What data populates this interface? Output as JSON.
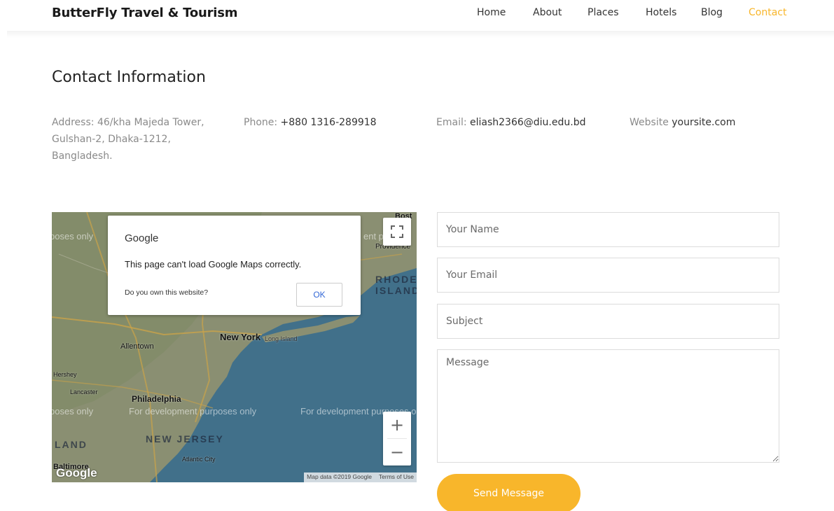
{
  "header": {
    "brand": "ButterFly Travel & Tourism",
    "nav": [
      {
        "label": "Home",
        "active": false
      },
      {
        "label": "About",
        "active": false
      },
      {
        "label": "Places",
        "active": false
      },
      {
        "label": "Hotels",
        "active": false
      },
      {
        "label": "Blog",
        "active": false
      },
      {
        "label": "Contact",
        "active": true
      }
    ]
  },
  "contact": {
    "title": "Contact Information",
    "address_label": "Address:",
    "address_lines": [
      "46/kha Majeda Tower,",
      "Gulshan-2, Dhaka-1212,",
      "Bangladesh."
    ],
    "phone_label": "Phone:",
    "phone": "+880 1316-289918",
    "email_label": "Email:",
    "email": "eliash2366@diu.edu.bd",
    "website_label": "Website",
    "website": "yoursite.com"
  },
  "map": {
    "dialog_brand": "Google",
    "dialog_message": "This page can't load Google Maps correctly.",
    "dialog_question": "Do you own this website?",
    "dialog_ok": "OK",
    "watermark": "For development purposes only",
    "watermark_left": "poses only",
    "watermark_right": "ent p",
    "places": {
      "new_york": "New York",
      "long_island": "Long Island",
      "allentown": "Allentown",
      "philadelphia": "Philadelphia",
      "lancaster": "Lancaster",
      "hershey": "Hershey",
      "atlantic_city": "Atlantic City",
      "baltimore": "Baltimore",
      "providence": "Providence",
      "rhode": "RHODE",
      "island": "ISLAND",
      "new_jersey": "NEW JERSEY",
      "land": "LAND",
      "bost": "Bost"
    },
    "zoom_in": "+",
    "zoom_out": "−",
    "logo": "Google",
    "attribution": "Map data ©2019 Google",
    "terms": "Terms of Use",
    "fullscreen_icon": "fullscreen-icon"
  },
  "form": {
    "name_placeholder": "Your Name",
    "email_placeholder": "Your Email",
    "subject_placeholder": "Subject",
    "message_placeholder": "Message",
    "submit_label": "Send Message"
  },
  "colors": {
    "accent": "#f8b62b",
    "text_muted": "#8a8a8a",
    "map_water": "#3f6d85"
  }
}
